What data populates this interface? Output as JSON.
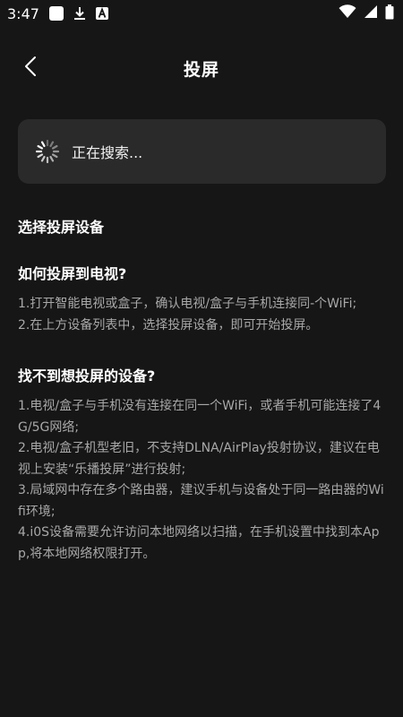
{
  "status_bar": {
    "time": "3:47",
    "left_icons": [
      "app-square-icon",
      "download-icon",
      "a-badge-icon"
    ],
    "right_icons": [
      "wifi-icon",
      "signal-icon",
      "battery-icon"
    ]
  },
  "header": {
    "title": "投屏",
    "back_icon": "chevron-left-icon"
  },
  "search": {
    "status_text": "正在搜索..."
  },
  "content": {
    "select_device_title": "选择投屏设备",
    "how_title": "如何投屏到电视?",
    "how_steps": [
      "1.打开智能电视或盒子，确认电视/盒子与手机连接同-个WiFi;",
      "2.在上方设备列表中，选择投屏设备，即可开始投屏。"
    ],
    "not_found_title": "找不到想投屏的设备?",
    "not_found_steps": [
      "1.电视/盒子与手机没有连接在同一个WiFi，或者手机可能连接了4G/5G网络;",
      "2.电视/盒子机型老旧，不支持DLNA/AirPlay投射协议，建议在电视上安装“乐播投屏”进行投射;",
      "3.局域网中存在多个路由器，建议手机与设备处于同一路由器的Wifi环境;",
      "4.i0S设备需要允许访问本地网络以扫描，在手机设置中找到本App,将本地网络权限打开。"
    ]
  },
  "colors": {
    "background": "#161616",
    "card": "#2a2a2a",
    "text_primary": "#ffffff",
    "text_secondary": "#a8a8a8"
  }
}
